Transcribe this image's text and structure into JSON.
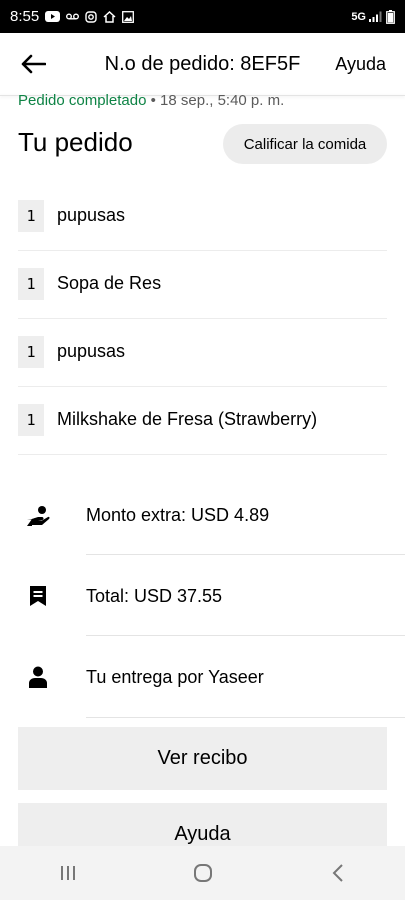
{
  "status_bar": {
    "time": "8:55",
    "network": "5G"
  },
  "header": {
    "title": "N.o de pedido: 8EF5F",
    "help": "Ayuda"
  },
  "order": {
    "status": "Pedido completado",
    "separator": " • ",
    "date": "18 sep., 5:40 p. m.",
    "heading": "Tu pedido",
    "rate_button": "Calificar la comida"
  },
  "items": [
    {
      "qty": "1",
      "name": "pupusas"
    },
    {
      "qty": "1",
      "name": "Sopa de Res"
    },
    {
      "qty": "1",
      "name": "pupusas"
    },
    {
      "qty": "1",
      "name": "Milkshake de Fresa (Strawberry)"
    }
  ],
  "info": {
    "tip": "Monto extra: USD 4.89",
    "total": "Total: USD 37.55",
    "courier": "Tu entrega por Yaseer"
  },
  "buttons": {
    "receipt": "Ver recibo",
    "help": "Ayuda"
  },
  "icons": {
    "back": "arrow-left-icon",
    "tip": "hand-coin-icon",
    "total": "receipt-icon",
    "courier": "person-icon",
    "nav_recents": "recents-icon",
    "nav_home": "home-icon",
    "nav_back": "chevron-left-icon"
  },
  "colors": {
    "completed_status": "#0e8345",
    "button_bg": "#eeeeee"
  }
}
